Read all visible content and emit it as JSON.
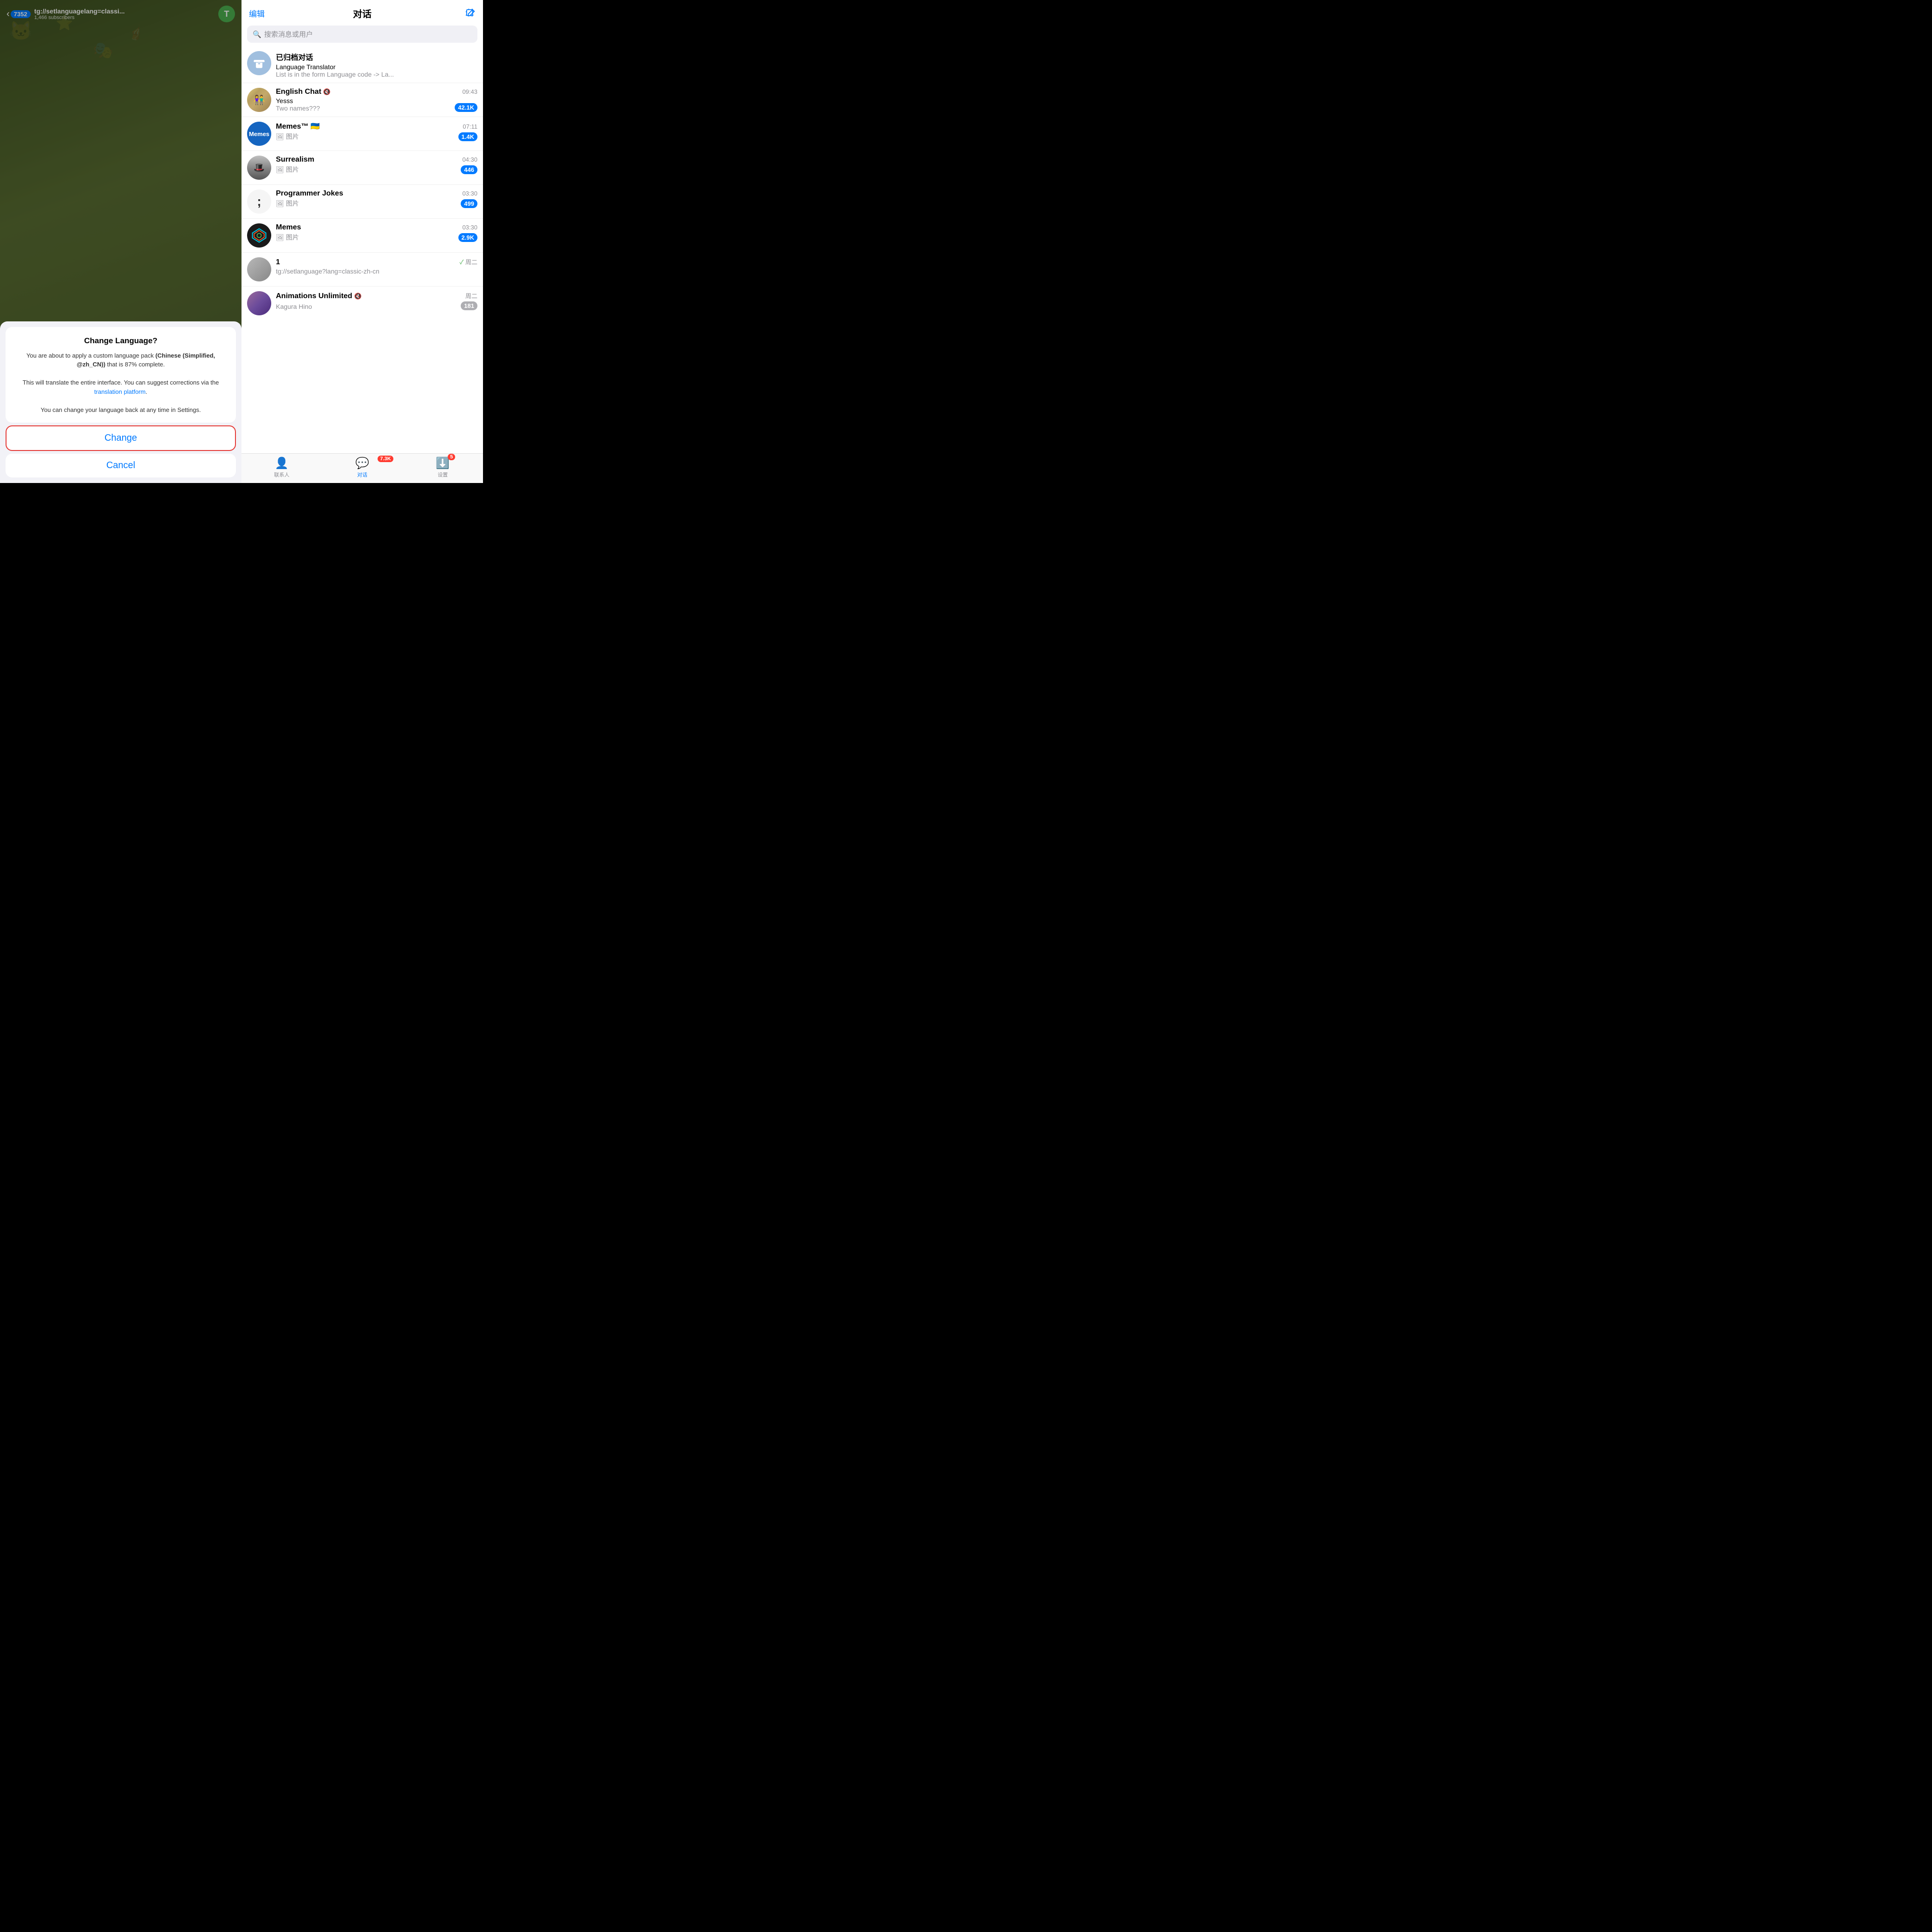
{
  "left": {
    "backCount": "7352",
    "channelUrl": "tg://setlanguagelang=classi...",
    "channelSubtitle": "1,466 subscribers",
    "avatarLetter": "T",
    "modal": {
      "title": "Change Language?",
      "body1": "You are about to apply a custom language pack",
      "body2": "(Chinese (Simplified, @zh_CN))",
      "body3": "that is 87% complete.",
      "body4": "This will translate the entire interface. You can suggest corrections via the",
      "linkText": "translation platform",
      "body5": ".",
      "body6": "You can change your language back at any time in Settings.",
      "changeBtnLabel": "Change",
      "cancelBtnLabel": "Cancel"
    }
  },
  "right": {
    "header": {
      "editLabel": "编辑",
      "title": "对话",
      "composeIcon": "✎"
    },
    "search": {
      "placeholder": "搜索消息或用户"
    },
    "chats": [
      {
        "id": "archive",
        "name": "已归档对话",
        "preview1": "Language Translator",
        "preview2": "List is in the form  Language code -> La...",
        "time": "",
        "badge": "",
        "avatarType": "archive"
      },
      {
        "id": "english",
        "name": "English Chat",
        "mute": true,
        "preview1": "Yesss",
        "preview2": "Two names???",
        "time": "09:43",
        "badge": "42.1K",
        "badgeGray": false,
        "avatarType": "english"
      },
      {
        "id": "memes-ukraine",
        "name": "Memes™ 🇺🇦",
        "mute": false,
        "preview1": "🖼 图片",
        "preview2": "",
        "time": "07:11",
        "badge": "1.4K",
        "badgeGray": false,
        "avatarType": "memes-ukraine",
        "avatarText": "Memes"
      },
      {
        "id": "surrealism",
        "name": "Surrealism",
        "mute": false,
        "preview1": "🖼 图片",
        "preview2": "",
        "time": "04:30",
        "badge": "446",
        "badgeGray": false,
        "avatarType": "surrealism"
      },
      {
        "id": "programmer",
        "name": "Programmer Jokes",
        "mute": false,
        "preview1": "🖼 图片",
        "preview2": "",
        "time": "03:30",
        "badge": "499",
        "badgeGray": false,
        "avatarType": "programmer"
      },
      {
        "id": "memes9",
        "name": "Memes",
        "mute": false,
        "preview1": "🖼 图片",
        "preview2": "",
        "time": "03:30",
        "badge": "2.9K",
        "badgeGray": false,
        "avatarType": "memes9"
      },
      {
        "id": "one",
        "name": "1",
        "mute": false,
        "preview1": "tg://setlanguage?lang=classic-zh-cn",
        "preview2": "",
        "time": "周二",
        "tick": true,
        "badge": "",
        "avatarType": "one"
      },
      {
        "id": "animations",
        "name": "Animations Unlimited",
        "mute": true,
        "preview1": "Kagura Hino",
        "preview2": "",
        "time": "周二",
        "badge": "181",
        "badgeGray": true,
        "avatarType": "animations"
      }
    ],
    "tabBar": {
      "contacts": "联系人",
      "chats": "对话",
      "settings": "设置",
      "chatsBadge": "7.3K",
      "settingsBadge": "5"
    }
  }
}
